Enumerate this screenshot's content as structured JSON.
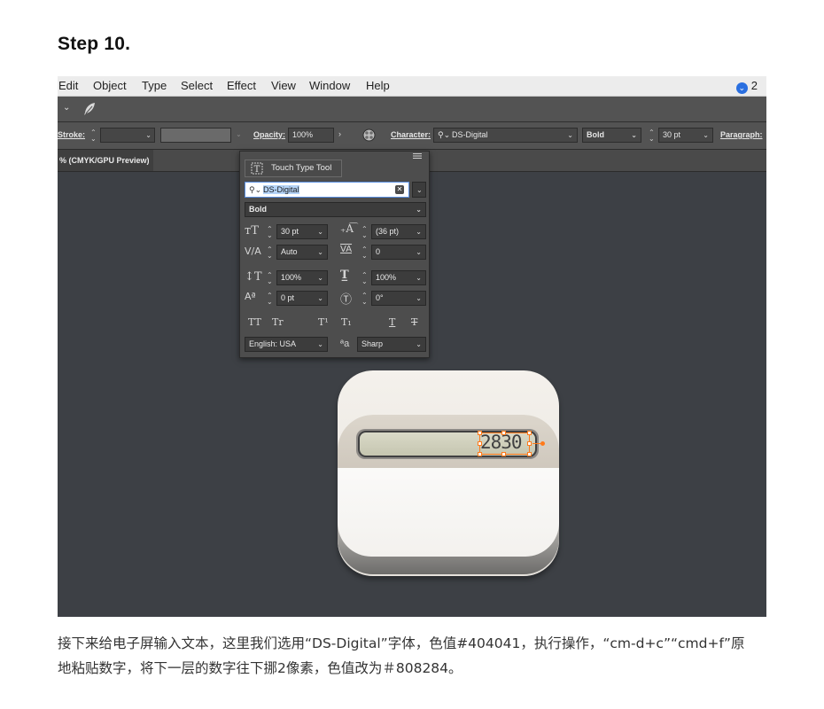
{
  "step_title": "Step 10.",
  "menubar": {
    "items": [
      "Edit",
      "Object",
      "Type",
      "Select",
      "Effect",
      "View",
      "Window",
      "Help"
    ],
    "notification_count": "2"
  },
  "controlbar": {
    "stroke_label": "Stroke:",
    "opacity_label": "Opacity:",
    "opacity_value": "100%",
    "character_label": "Character:",
    "font_name": "DS-Digital",
    "font_style": "Bold",
    "font_size": "30 pt",
    "paragraph_label": "Paragraph:"
  },
  "document_tab": "% (CMYK/GPU Preview)",
  "character_panel": {
    "touch_type_label": "Touch Type Tool",
    "font_search_value": "DS-Digital",
    "font_style": "Bold",
    "font_size": "30 pt",
    "leading": "(36 pt)",
    "kerning": "Auto",
    "tracking": "0",
    "vertical_scale": "100%",
    "horizontal_scale": "100%",
    "baseline_shift": "0 pt",
    "rotation": "0°",
    "format_buttons": [
      "TT",
      "Tr",
      "T¹",
      "T₁",
      "T",
      "T"
    ],
    "language": "English: USA",
    "antialias_glyph": "ªa",
    "antialias": "Sharp"
  },
  "artwork": {
    "lcd_text": "2830",
    "text_color": "#404041",
    "shadow_text_color": "#808284",
    "selection_color": "#ff7a1a"
  },
  "caption": "接下来给电子屏输入文本，这里我们选用“DS-Digital”字体，色值#404041，执行操作，“cm-d+c”“cmd+f”原地粘贴数字，将下一层的数字往下挪2像素，色值改为＃808284。"
}
